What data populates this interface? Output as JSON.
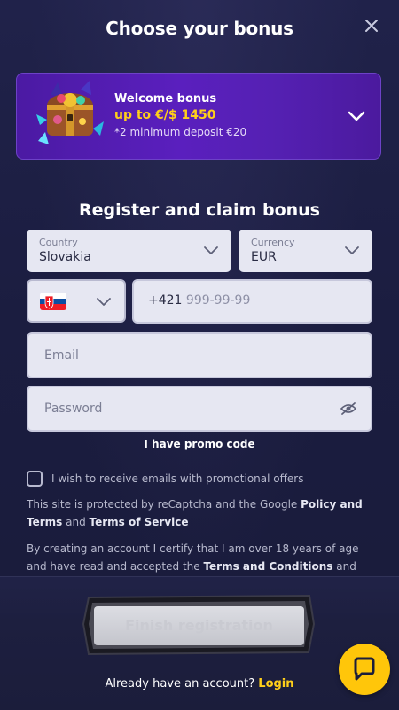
{
  "header": {
    "title": "Choose your bonus"
  },
  "bonus": {
    "label": "Welcome bonus",
    "amount": "up to €/$ 1450",
    "note": "*2 minimum deposit €20",
    "accent_color": "#ffcf1a"
  },
  "form": {
    "title": "Register and claim bonus",
    "country": {
      "label": "Country",
      "value": "Slovakia"
    },
    "currency": {
      "label": "Currency",
      "value": "EUR"
    },
    "phone": {
      "prefix": "+421",
      "placeholder": "999-99-99",
      "flag": "slovakia-flag-icon"
    },
    "email": {
      "placeholder": "Email"
    },
    "password": {
      "placeholder": "Password"
    },
    "promo_link": "I have promo code",
    "consent_label": "I wish to receive emails with promotional offers",
    "legal1": {
      "pre": "This site is protected by reCaptcha and the Google ",
      "link1": "Policy and Terms",
      "mid": " and ",
      "link2": "Terms of Service"
    },
    "legal2": {
      "pre": "By creating an account I certify that I am over 18 years of age and have read and accepted the ",
      "link": "Terms and Conditions",
      "post": " and"
    }
  },
  "footer": {
    "finish_label": "Finish registration",
    "login_prompt": "Already have an account?",
    "login_label": "Login"
  },
  "colors": {
    "background": "#1d1f3d",
    "brand_purple": "#5a1fbe",
    "accent_yellow": "#ffc60a"
  }
}
